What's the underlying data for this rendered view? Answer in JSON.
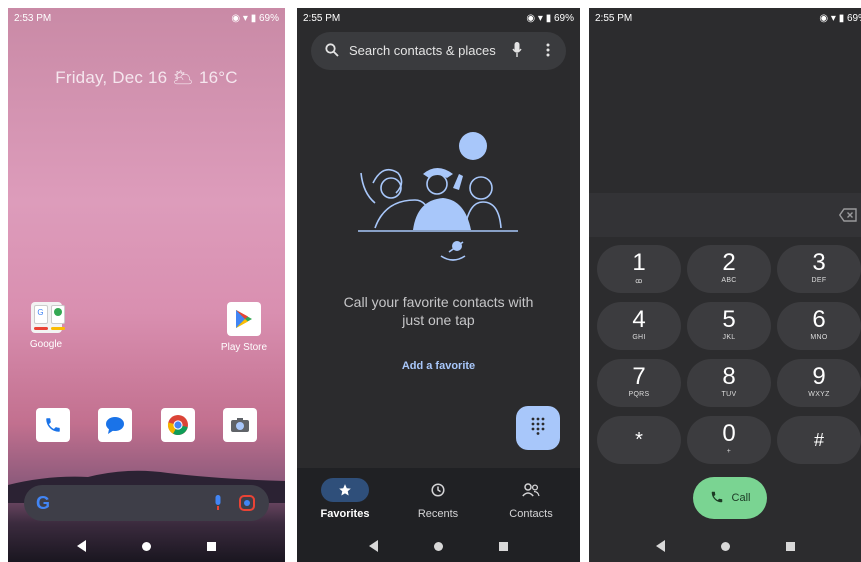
{
  "phone1": {
    "status": {
      "time": "2:53 PM",
      "battery": "69%"
    },
    "date_weather": "Friday, Dec 16 🌥 16°C",
    "apps": [
      {
        "label": "Google"
      },
      {
        "label": "Play Store"
      }
    ],
    "dock_icons": [
      "phone-icon",
      "messages-icon",
      "chrome-icon",
      "camera-icon"
    ],
    "search": {
      "g_icon": "google-g-icon",
      "mic": "mic-icon",
      "lens": "lens-icon"
    }
  },
  "phone2": {
    "status": {
      "time": "2:55 PM",
      "battery": "69%"
    },
    "search_placeholder": "Search contacts & places",
    "message": "Call your favorite contacts with just one tap",
    "add_favorite": "Add a favorite",
    "tabs": [
      {
        "label": "Favorites",
        "icon": "star-icon",
        "active": true
      },
      {
        "label": "Recents",
        "icon": "clock-icon",
        "active": false
      },
      {
        "label": "Contacts",
        "icon": "people-icon",
        "active": false
      }
    ]
  },
  "phone3": {
    "status": {
      "time": "2:55 PM",
      "battery": "69%"
    },
    "keys": [
      {
        "n": "1",
        "l": "ꝏ"
      },
      {
        "n": "2",
        "l": "ABC"
      },
      {
        "n": "3",
        "l": "DEF"
      },
      {
        "n": "4",
        "l": "GHI"
      },
      {
        "n": "5",
        "l": "JKL"
      },
      {
        "n": "6",
        "l": "MNO"
      },
      {
        "n": "7",
        "l": "PQRS"
      },
      {
        "n": "8",
        "l": "TUV"
      },
      {
        "n": "9",
        "l": "WXYZ"
      },
      {
        "n": "*",
        "l": ""
      },
      {
        "n": "0",
        "l": "+"
      },
      {
        "n": "#",
        "l": ""
      }
    ],
    "call_label": "Call"
  },
  "colors": {
    "accent_blue": "#a8c7fa",
    "call_green": "#7ad492"
  }
}
